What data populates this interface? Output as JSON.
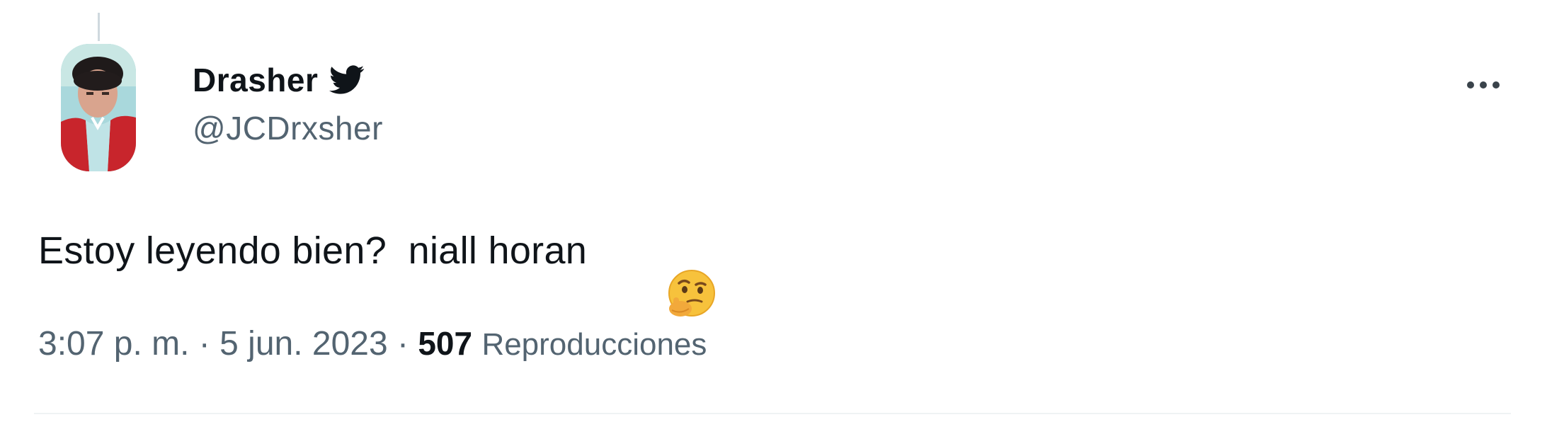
{
  "tweet": {
    "display_name": "Drasher",
    "handle": "@JCDrxsher",
    "text": "Estoy leyendo bien?  niall horan",
    "emoji": "thinking-face",
    "time": "3:07 p. m.",
    "separator": "·",
    "date": "5 jun. 2023",
    "views_count": "507",
    "views_label": "Reproducciones"
  },
  "icons": {
    "platform": "twitter-bird-icon",
    "more": "more-options-icon"
  },
  "colors": {
    "primary_text": "#0f1419",
    "secondary_text": "#536471",
    "divider": "#eff3f4",
    "background": "#ffffff"
  }
}
